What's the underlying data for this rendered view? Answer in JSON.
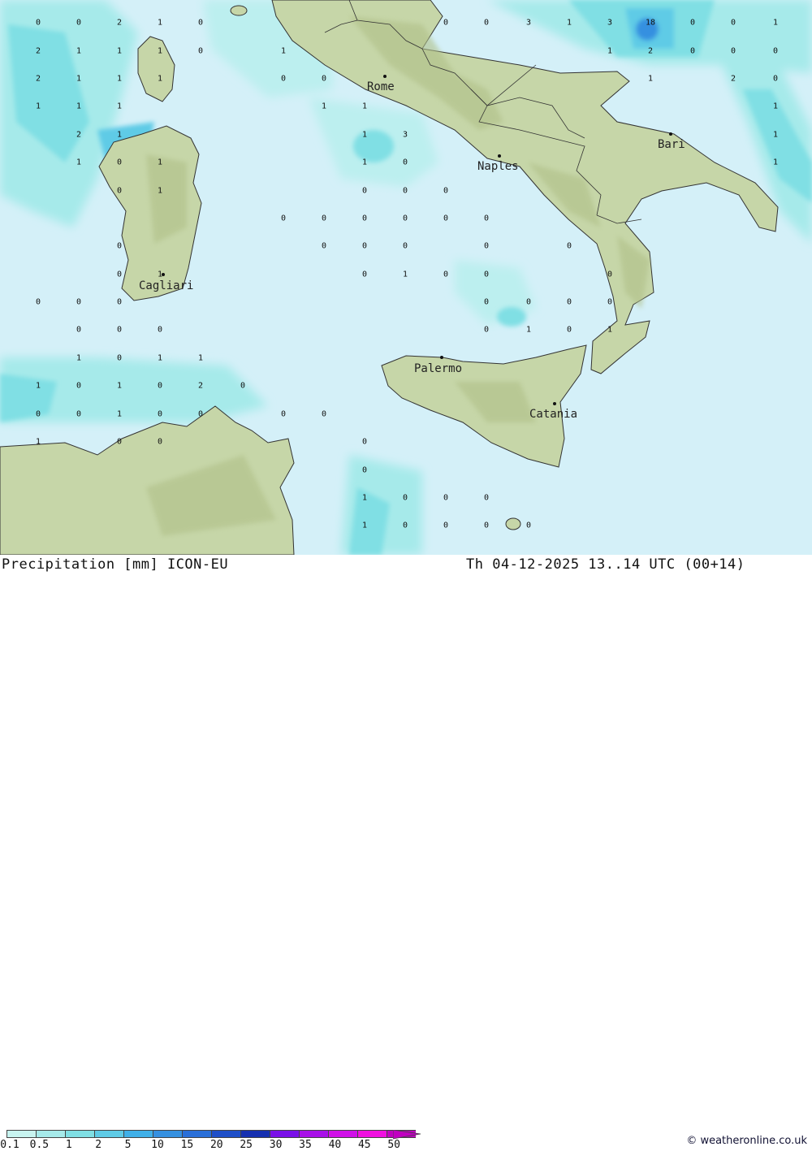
{
  "title": "Precipitation [mm] ICON-EU",
  "datetime": "Th 04-12-2025 13..14 UTC (00+14)",
  "credit": "© weatheronline.co.uk",
  "legend": {
    "ticks": [
      "0.1",
      "0.5",
      "1",
      "2",
      "5",
      "10",
      "15",
      "20",
      "25",
      "30",
      "35",
      "40",
      "45",
      "50"
    ],
    "colors": [
      "#c8f4f0",
      "#a6eaea",
      "#80dfe4",
      "#5fcbe6",
      "#40b0e8",
      "#3590e0",
      "#2a6fd8",
      "#1f4fc8",
      "#1630b0",
      "#7a10e8",
      "#a810e8",
      "#d010e8",
      "#f010e0",
      "#c000c0"
    ]
  },
  "cities": [
    {
      "name": "Rome"
    },
    {
      "name": "Naples"
    },
    {
      "name": "Bari"
    },
    {
      "name": "Cagliari"
    },
    {
      "name": "Palermo"
    },
    {
      "name": "Catania"
    }
  ],
  "values": [
    "0",
    "0",
    "2",
    "1",
    "0",
    "0",
    "0",
    "3",
    "1",
    "3",
    "18",
    "0",
    "0",
    "1",
    "2",
    "1",
    "1",
    "1",
    "0",
    "1",
    "1",
    "2",
    "0",
    "0",
    "0",
    "2",
    "1",
    "1",
    "1",
    "0",
    "0",
    "1",
    "2",
    "0",
    "1",
    "1",
    "1",
    "1",
    "1",
    "1",
    "2",
    "1",
    "1",
    "3",
    "1",
    "1",
    "0",
    "1",
    "1",
    "0",
    "1",
    "0",
    "1",
    "0",
    "0",
    "0",
    "0",
    "0",
    "0",
    "0",
    "0",
    "0",
    "0",
    "0",
    "0",
    "0",
    "0",
    "0",
    "0",
    "1",
    "0",
    "1",
    "0",
    "0",
    "0",
    "0",
    "0",
    "0",
    "0",
    "0",
    "0",
    "0",
    "0",
    "0",
    "0",
    "0",
    "1",
    "0",
    "1",
    "1",
    "0",
    "1",
    "1",
    "1",
    "0",
    "1",
    "0",
    "2",
    "0",
    "0",
    "0",
    "1",
    "0",
    "0",
    "0",
    "0",
    "1",
    "0",
    "0",
    "0",
    "0",
    "1",
    "0",
    "0",
    "0",
    "1",
    "0",
    "0",
    "0",
    "0"
  ]
}
